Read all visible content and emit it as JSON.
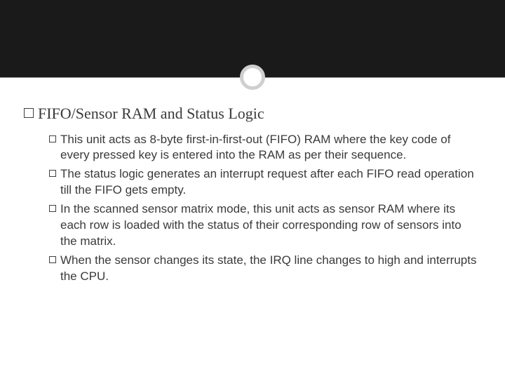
{
  "heading": {
    "title": "FIFO/Sensor RAM and Status Logic"
  },
  "bullets": [
    {
      "text": "This unit acts as 8-byte first-in-first-out (FIFO) RAM where the key code of every pressed key is entered into the RAM as per their sequence."
    },
    {
      "text": "The status logic generates an interrupt request after each FIFO read operation till the FIFO gets empty."
    },
    {
      "text": "In the scanned sensor matrix mode, this unit acts as sensor RAM where its each row is loaded with the status of their corresponding row of sensors into the matrix."
    },
    {
      "text": "When the sensor changes its state, the IRQ line changes to high and interrupts the CPU."
    }
  ]
}
